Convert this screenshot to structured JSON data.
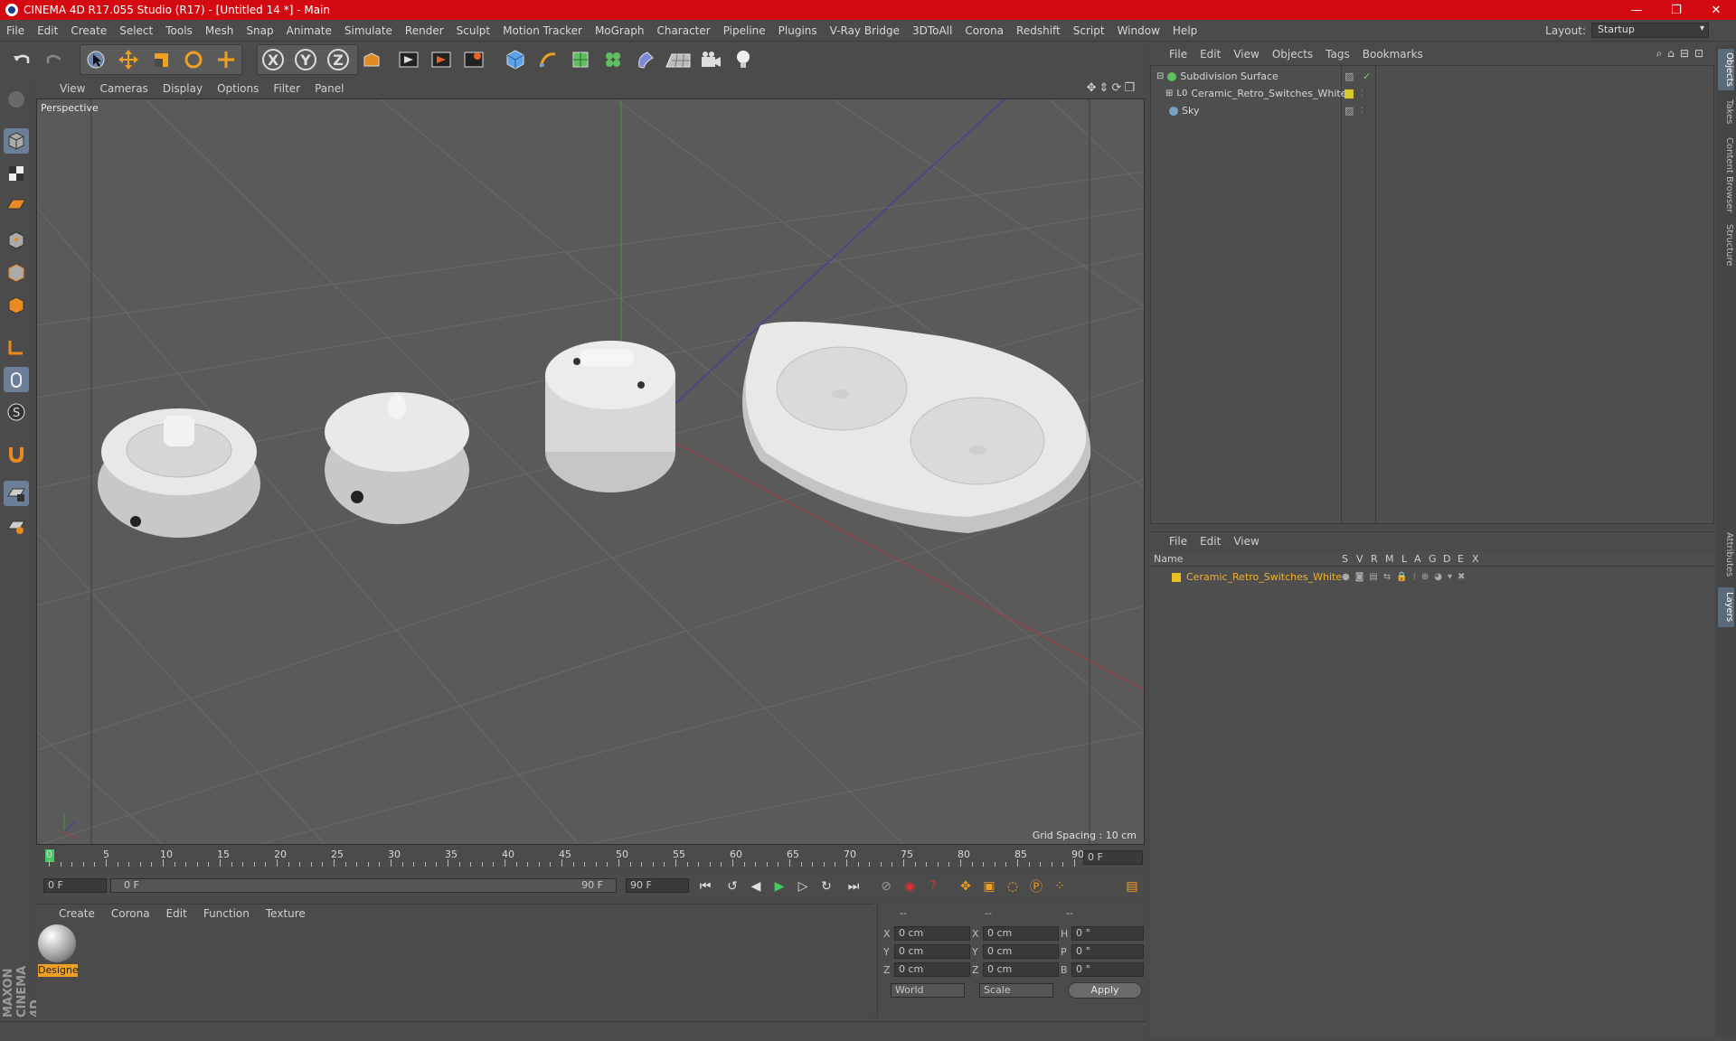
{
  "window": {
    "title": "CINEMA 4D R17.055 Studio (R17) - [Untitled 14 *] - Main",
    "buttons": [
      "—",
      "❐",
      "✕"
    ]
  },
  "menubar": {
    "items": [
      "File",
      "Edit",
      "Create",
      "Select",
      "Tools",
      "Mesh",
      "Snap",
      "Animate",
      "Simulate",
      "Render",
      "Sculpt",
      "Motion Tracker",
      "MoGraph",
      "Character",
      "Pipeline",
      "Plugins",
      "V-Ray Bridge",
      "3DToAll",
      "Corona",
      "Redshift",
      "Script",
      "Window",
      "Help"
    ],
    "layout_label": "Layout:",
    "layout_value": "Startup"
  },
  "toolbar": {
    "icons": [
      "undo-icon",
      "redo-icon",
      "live-select-icon",
      "move-icon",
      "scale-icon",
      "rotate-icon",
      "transform-icon",
      "x-axis-lock-icon",
      "y-axis-lock-icon",
      "z-axis-lock-icon",
      "coordinate-system-icon",
      "render-view-icon",
      "render-to-picture-viewer-icon",
      "edit-render-settings-icon",
      "cube-icon",
      "pen-icon",
      "subdivision-surface-icon",
      "cloner-icon",
      "deformer-icon",
      "floor-icon",
      "camera-icon",
      "light-icon"
    ],
    "axis_labels": [
      "X",
      "Y",
      "Z"
    ]
  },
  "viewport": {
    "menu": [
      "View",
      "Cameras",
      "Display",
      "Options",
      "Filter",
      "Panel"
    ],
    "label": "Perspective",
    "grid_spacing": "Grid Spacing : 10 cm"
  },
  "timeline": {
    "ticks": [
      "0",
      "5",
      "10",
      "15",
      "20",
      "25",
      "30",
      "35",
      "40",
      "45",
      "50",
      "55",
      "60",
      "65",
      "70",
      "75",
      "80",
      "85",
      "90"
    ],
    "current_frame": "0 F",
    "start_field": "0 F",
    "range_start": "0 F",
    "range_end": "90 F",
    "end_field": "90 F"
  },
  "materials": {
    "menu": [
      "Create",
      "Corona",
      "Edit",
      "Function",
      "Texture"
    ],
    "items": [
      {
        "label": "Designe"
      }
    ]
  },
  "coords": {
    "headers": [
      "--",
      "--",
      "--"
    ],
    "rows": [
      {
        "a": "X",
        "av": "0 cm",
        "b": "X",
        "bv": "0 cm",
        "c": "H",
        "cv": "0 °"
      },
      {
        "a": "Y",
        "av": "0 cm",
        "b": "Y",
        "bv": "0 cm",
        "c": "P",
        "cv": "0 °"
      },
      {
        "a": "Z",
        "av": "0 cm",
        "b": "Z",
        "bv": "0 cm",
        "c": "B",
        "cv": "0 °"
      }
    ],
    "mode": "World",
    "transform": "Scale",
    "apply": "Apply"
  },
  "objects": {
    "menu": [
      "File",
      "Edit",
      "View",
      "Objects",
      "Tags",
      "Bookmarks"
    ],
    "items": [
      {
        "name": "Subdivision Surface",
        "color": "#5fbf5f"
      },
      {
        "name": "Ceramic_Retro_Switches_White",
        "color": "#d9c826"
      },
      {
        "name": "Sky",
        "color": "#7aa0c8"
      }
    ]
  },
  "layers": {
    "menu": [
      "File",
      "Edit",
      "View"
    ],
    "header": {
      "name": "Name",
      "cols": [
        "S",
        "V",
        "R",
        "M",
        "L",
        "A",
        "G",
        "D",
        "E",
        "X"
      ]
    },
    "items": [
      {
        "name": "Ceramic_Retro_Switches_White",
        "color": "#e8c020"
      }
    ]
  },
  "right_tabs": [
    "Objects",
    "Takes",
    "Content Browser",
    "Structure",
    "Attributes",
    "Layers"
  ],
  "brand": "MAXON CINEMA 4D"
}
